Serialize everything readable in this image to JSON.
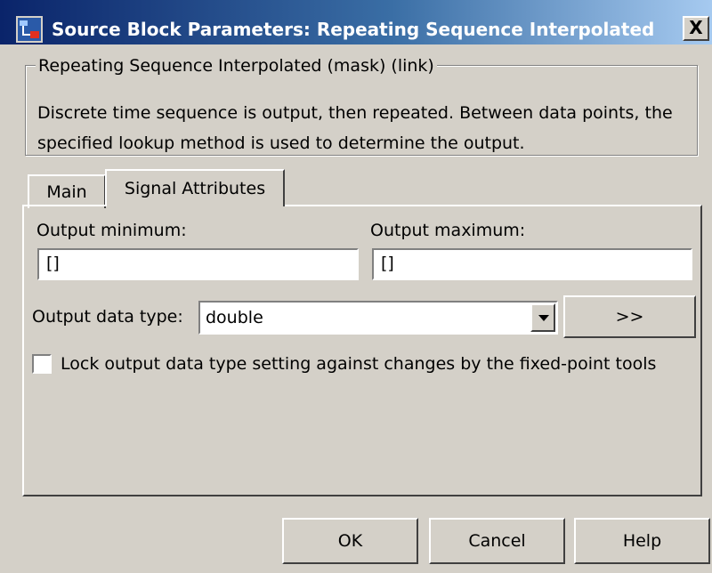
{
  "window": {
    "title": "Source Block Parameters: Repeating Sequence Interpolated",
    "close_label": "X",
    "icon": "simulink-block-icon"
  },
  "group": {
    "legend": "Repeating Sequence Interpolated (mask) (link)",
    "description": "Discrete time sequence is output, then repeated.  Between data points, the specified lookup method is used to determine the output."
  },
  "tabs": [
    {
      "label": "Main",
      "selected": false
    },
    {
      "label": "Signal Attributes",
      "selected": true
    }
  ],
  "fields": {
    "output_minimum": {
      "label": "Output minimum:",
      "value": "[]"
    },
    "output_maximum": {
      "label": "Output maximum:",
      "value": "[]"
    },
    "output_data_type": {
      "label": "Output data type:",
      "value": "double"
    }
  },
  "buttons": {
    "data_type_assistant": ">>",
    "ok": "OK",
    "cancel": "Cancel",
    "help": "Help"
  },
  "lock_checkbox": {
    "label": "Lock output data type setting against changes by the fixed-point tools",
    "checked": false
  }
}
